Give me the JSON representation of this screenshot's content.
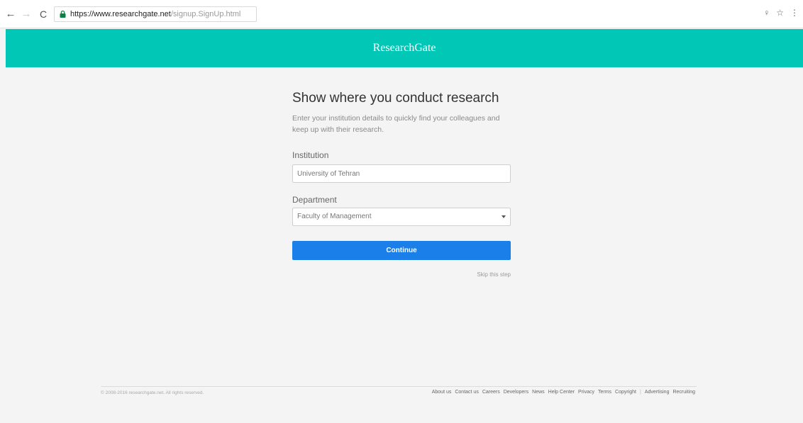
{
  "browser": {
    "url_host": "https://www.researchgate.net",
    "url_path": "/signup.SignUp.html"
  },
  "header": {
    "logo_text": "ResearchGate",
    "brand_color": "#00c7b6"
  },
  "form": {
    "title": "Show where you conduct research",
    "subtitle": "Enter your institution details to quickly find your colleagues and keep up with their research.",
    "institution_label": "Institution",
    "institution_value": "University of Tehran",
    "department_label": "Department",
    "department_value": "Faculty of Management",
    "continue_label": "Continue",
    "skip_label": "Skip this step",
    "button_color": "#1a7fe8"
  },
  "footer": {
    "copyright": "© 2008-2016 researchgate.net. All rights reserved.",
    "links": [
      "About us",
      "Contact us",
      "Careers",
      "Developers",
      "News",
      "Help Center",
      "Privacy",
      "Terms",
      "Copyright"
    ],
    "separator": "|",
    "extra_links": [
      "Advertising",
      "Recruiting"
    ]
  }
}
